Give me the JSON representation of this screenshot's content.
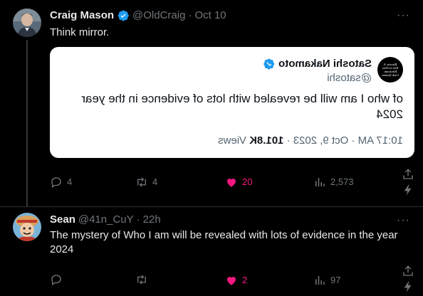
{
  "tweet1": {
    "name": "Craig Mason",
    "handle": "@OldCraig",
    "dot": "·",
    "time": "Oct 10",
    "more": "···",
    "text": "Think mirror.",
    "quote": {
      "avatar_text": "Bitcoin: A Peer-to-Peer Electronic Cash System",
      "name": "Satoshi Nakamoto",
      "handle": "@satoshi",
      "text": "of who I am will be revealed with lots of evidence in the year 2024",
      "time": "10:17 AM · Oct 9, 2023 · ",
      "views_count": "101.8K",
      "views_label": " Views"
    },
    "actions": {
      "replies": "4",
      "reposts": "4",
      "likes": "20",
      "views": "2,573"
    }
  },
  "tweet2": {
    "name": "Sean",
    "handle": "@41n_CuY",
    "dot": "·",
    "time": "22h",
    "more": "···",
    "text": "The mystery of Who I am will be revealed with lots of evidence in the year 2024",
    "actions": {
      "replies": "",
      "reposts": "",
      "likes": "2",
      "views": "97"
    }
  },
  "colors": {
    "accent": "#1d9bf0",
    "like": "#f91880",
    "muted": "#71767b",
    "background": "#000000"
  }
}
